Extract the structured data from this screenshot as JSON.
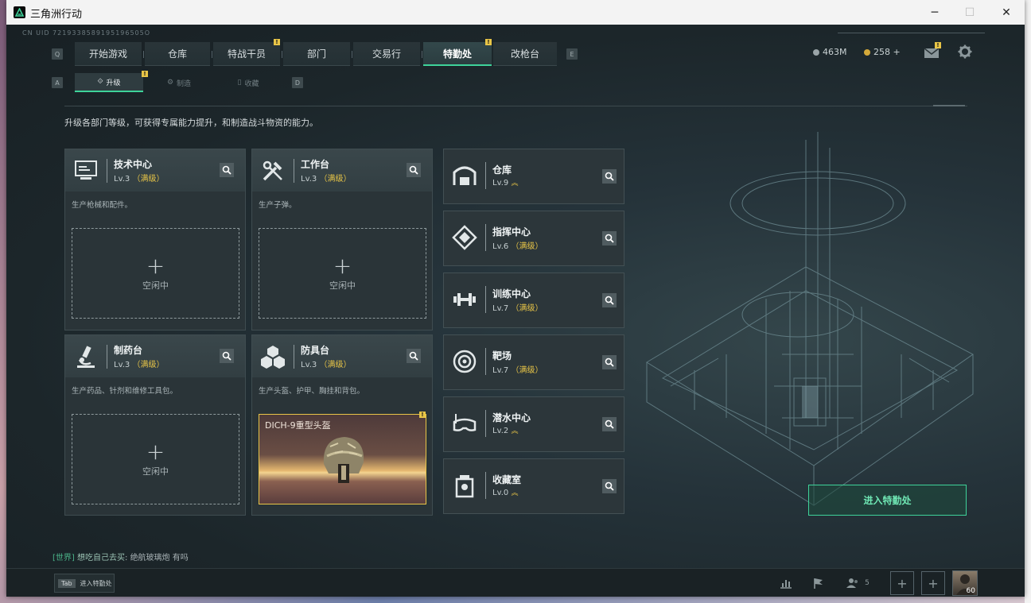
{
  "window": {
    "title": "三角洲行动",
    "controls": [
      "─",
      "☐",
      "✕"
    ]
  },
  "uid": "CN UID 7219338589195196505O",
  "nav": {
    "left_key": "Q",
    "right_key": "E",
    "tabs": [
      "开始游戏",
      "仓库",
      "特战干员",
      "部门",
      "交易行",
      "特勤处",
      "改枪台"
    ],
    "active_tab": "特勤处"
  },
  "subnav": {
    "left_key": "A",
    "right_key": "D",
    "tabs": [
      "升级",
      "制造",
      "收藏"
    ],
    "active": "升级"
  },
  "resources": {
    "silver": "463M",
    "gold": "258 +"
  },
  "badge_mark": "!",
  "description": "升级各部门等级，可获得专属能力提升，和制造战斗物资的能力。",
  "workshops": [
    {
      "name": "技术中心",
      "level": "Lv.3",
      "max": "（满级）",
      "desc": "生产枪械和配件。",
      "slot": {
        "plus": "+",
        "status": "空闲中"
      },
      "icon": "computer-icon"
    },
    {
      "name": "工作台",
      "level": "Lv.3",
      "max": "（满级）",
      "desc": "生产子弹。",
      "slot": {
        "plus": "+",
        "status": "空闲中"
      },
      "icon": "tools-icon"
    },
    {
      "name": "制药台",
      "level": "Lv.3",
      "max": "（满级）",
      "desc": "生产药品、针剂和维修工具包。",
      "slot": {
        "plus": "+",
        "status": "空闲中"
      },
      "icon": "microscope-icon"
    },
    {
      "name": "防具台",
      "level": "Lv.3",
      "max": "（满级）",
      "desc": "生产头盔、护甲、胸挂和背包。",
      "item": "DICH-9重型头盔",
      "icon": "armor-blocks-icon"
    }
  ],
  "facilities": [
    {
      "name": "仓库",
      "level": "Lv.9",
      "suffix": "︽",
      "icon": "warehouse-icon"
    },
    {
      "name": "指挥中心",
      "level": "Lv.6",
      "suffix": "（满级）",
      "icon": "command-icon"
    },
    {
      "name": "训练中心",
      "level": "Lv.7",
      "suffix": "（满级）",
      "icon": "dumbbell-icon"
    },
    {
      "name": "靶场",
      "level": "Lv.7",
      "suffix": "（满级）",
      "icon": "target-icon"
    },
    {
      "name": "潜水中心",
      "level": "Lv.2",
      "suffix": "︽",
      "icon": "dive-mask-icon"
    },
    {
      "name": "收藏室",
      "level": "Lv.0",
      "suffix": "︽",
      "icon": "collection-icon"
    }
  ],
  "enter_button": "进入特勤处",
  "chat": {
    "channel": "[世界]",
    "nick": "想吃自己去买",
    "message": "绝航玻璃炮 有吗"
  },
  "bottom": {
    "tab_key": "Tab",
    "tab_label": "进入特勤处",
    "friends_count": "5",
    "player_level": "60"
  },
  "colors": {
    "accent": "#3ed39a",
    "gold": "#e8c547",
    "bg": "#1f2a2e"
  }
}
